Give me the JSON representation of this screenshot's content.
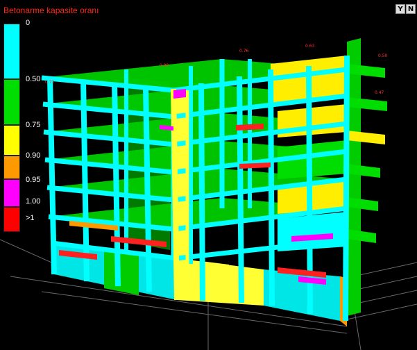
{
  "panel": {
    "title": "Betonarme kapasite oranı"
  },
  "toolbar": {
    "buttons": [
      {
        "label": "Y",
        "icon": "filter-icon"
      },
      {
        "label": "N",
        "icon": "north-icon"
      }
    ]
  },
  "legend": {
    "items": [
      {
        "label": "0",
        "color": "#00ffff"
      },
      {
        "label": "0.50",
        "color": "#00dd00"
      },
      {
        "label": "0.75",
        "color": "#ffff00"
      },
      {
        "label": "0.90",
        "color": "#ff9900"
      },
      {
        "label": "0.95",
        "color": "#ff00ff"
      },
      {
        "label": "1.00",
        "color": "#ff0000"
      },
      {
        "label": ">1",
        "color": "#ff0000"
      }
    ]
  },
  "colors": {
    "background": "#000000",
    "title_text": "#ff2a1a",
    "mesh_lines": "#1a1a1a",
    "ground_grid": "#777777"
  }
}
